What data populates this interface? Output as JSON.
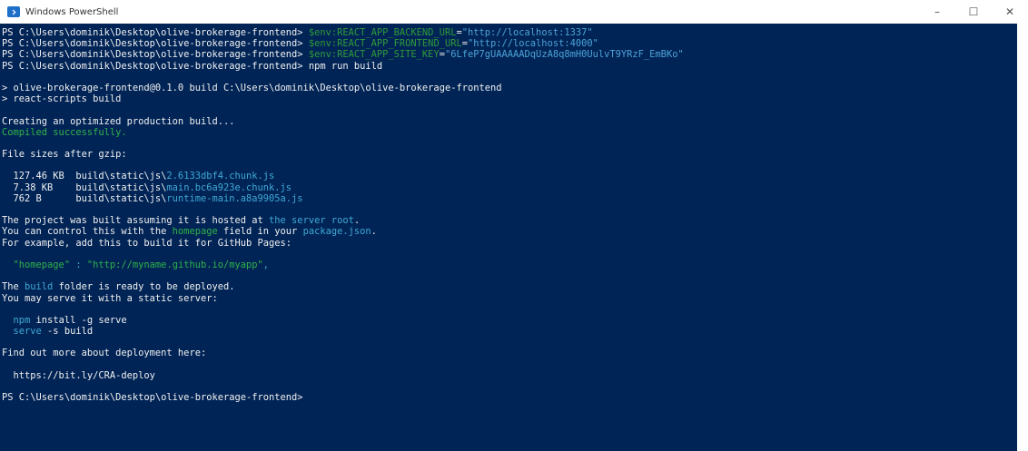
{
  "window": {
    "title": "Windows PowerShell",
    "controls": {
      "minimize": "–",
      "maximize": "☐",
      "close": "✕"
    }
  },
  "colors": {
    "background": "#012456",
    "text": "#e6e6e6",
    "variable": "#2f9a3a",
    "string": "#4da3d8",
    "success": "#2fb34a",
    "cyan": "#3fa9d6"
  },
  "lines": [
    [
      {
        "t": "PS C:\\Users\\dominik\\Desktop\\olive-brokerage-frontend> ",
        "c": "white"
      },
      {
        "t": "$env:REACT_APP_BACKEND_URL",
        "c": "var"
      },
      {
        "t": "=",
        "c": "white"
      },
      {
        "t": "\"http://localhost:1337\"",
        "c": "str"
      }
    ],
    [
      {
        "t": "PS C:\\Users\\dominik\\Desktop\\olive-brokerage-frontend> ",
        "c": "white"
      },
      {
        "t": "$env:REACT_APP_FRONTEND_URL",
        "c": "var"
      },
      {
        "t": "=",
        "c": "white"
      },
      {
        "t": "\"http://localhost:4000\"",
        "c": "str"
      }
    ],
    [
      {
        "t": "PS C:\\Users\\dominik\\Desktop\\olive-brokerage-frontend> ",
        "c": "white"
      },
      {
        "t": "$env:REACT_APP_SITE_KEY",
        "c": "var"
      },
      {
        "t": "=",
        "c": "white"
      },
      {
        "t": "\"6LfeP7gUAAAAADqUzA8q8mH0UulvT9YRzF_EmBKo\"",
        "c": "str"
      }
    ],
    [
      {
        "t": "PS C:\\Users\\dominik\\Desktop\\olive-brokerage-frontend> ",
        "c": "white"
      },
      {
        "t": "npm run build",
        "c": "white"
      }
    ],
    [
      {
        "t": "",
        "c": "white"
      }
    ],
    [
      {
        "t": "> olive-brokerage-frontend@0.1.0 build C:\\Users\\dominik\\Desktop\\olive-brokerage-frontend",
        "c": "white"
      }
    ],
    [
      {
        "t": "> react-scripts build",
        "c": "white"
      }
    ],
    [
      {
        "t": "",
        "c": "white"
      }
    ],
    [
      {
        "t": "Creating an optimized production build...",
        "c": "white"
      }
    ],
    [
      {
        "t": "Compiled successfully.",
        "c": "green"
      }
    ],
    [
      {
        "t": "",
        "c": "white"
      }
    ],
    [
      {
        "t": "File sizes after gzip:",
        "c": "white"
      }
    ],
    [
      {
        "t": "",
        "c": "white"
      }
    ],
    [
      {
        "t": "  127.46 KB  build\\static\\js\\",
        "c": "white"
      },
      {
        "t": "2.6133dbf4.chunk.js",
        "c": "cyan"
      }
    ],
    [
      {
        "t": "  7.38 KB    build\\static\\js\\",
        "c": "white"
      },
      {
        "t": "main.bc6a923e.chunk.js",
        "c": "cyan"
      }
    ],
    [
      {
        "t": "  762 B      build\\static\\js\\",
        "c": "white"
      },
      {
        "t": "runtime-main.a8a9905a.js",
        "c": "cyan"
      }
    ],
    [
      {
        "t": "",
        "c": "white"
      }
    ],
    [
      {
        "t": "The project was built assuming it is hosted at ",
        "c": "white"
      },
      {
        "t": "the server root",
        "c": "cyan"
      },
      {
        "t": ".",
        "c": "white"
      }
    ],
    [
      {
        "t": "You can control this with the ",
        "c": "white"
      },
      {
        "t": "homepage",
        "c": "green"
      },
      {
        "t": " field in your ",
        "c": "white"
      },
      {
        "t": "package.json",
        "c": "cyan"
      },
      {
        "t": ".",
        "c": "white"
      }
    ],
    [
      {
        "t": "For example, add this to build it for GitHub Pages:",
        "c": "white"
      }
    ],
    [
      {
        "t": "",
        "c": "white"
      }
    ],
    [
      {
        "t": "  ",
        "c": "white"
      },
      {
        "t": "\"homepage\"",
        "c": "green"
      },
      {
        "t": " : ",
        "c": "cyan"
      },
      {
        "t": "\"http://myname.github.io/myapp\"",
        "c": "green"
      },
      {
        "t": ",",
        "c": "cyan"
      }
    ],
    [
      {
        "t": "",
        "c": "white"
      }
    ],
    [
      {
        "t": "The ",
        "c": "white"
      },
      {
        "t": "build",
        "c": "cyan"
      },
      {
        "t": " folder is ready to be deployed.",
        "c": "white"
      }
    ],
    [
      {
        "t": "You may serve it with a static server:",
        "c": "white"
      }
    ],
    [
      {
        "t": "",
        "c": "white"
      }
    ],
    [
      {
        "t": "  ",
        "c": "white"
      },
      {
        "t": "npm",
        "c": "cyan"
      },
      {
        "t": " install -g serve",
        "c": "white"
      }
    ],
    [
      {
        "t": "  ",
        "c": "white"
      },
      {
        "t": "serve",
        "c": "cyan"
      },
      {
        "t": " -s build",
        "c": "white"
      }
    ],
    [
      {
        "t": "",
        "c": "white"
      }
    ],
    [
      {
        "t": "Find out more about deployment here:",
        "c": "white"
      }
    ],
    [
      {
        "t": "",
        "c": "white"
      }
    ],
    [
      {
        "t": "  https://bit.ly/CRA-deploy",
        "c": "white"
      }
    ],
    [
      {
        "t": "",
        "c": "white"
      }
    ],
    [
      {
        "t": "PS C:\\Users\\dominik\\Desktop\\olive-brokerage-frontend>",
        "c": "white"
      }
    ]
  ]
}
